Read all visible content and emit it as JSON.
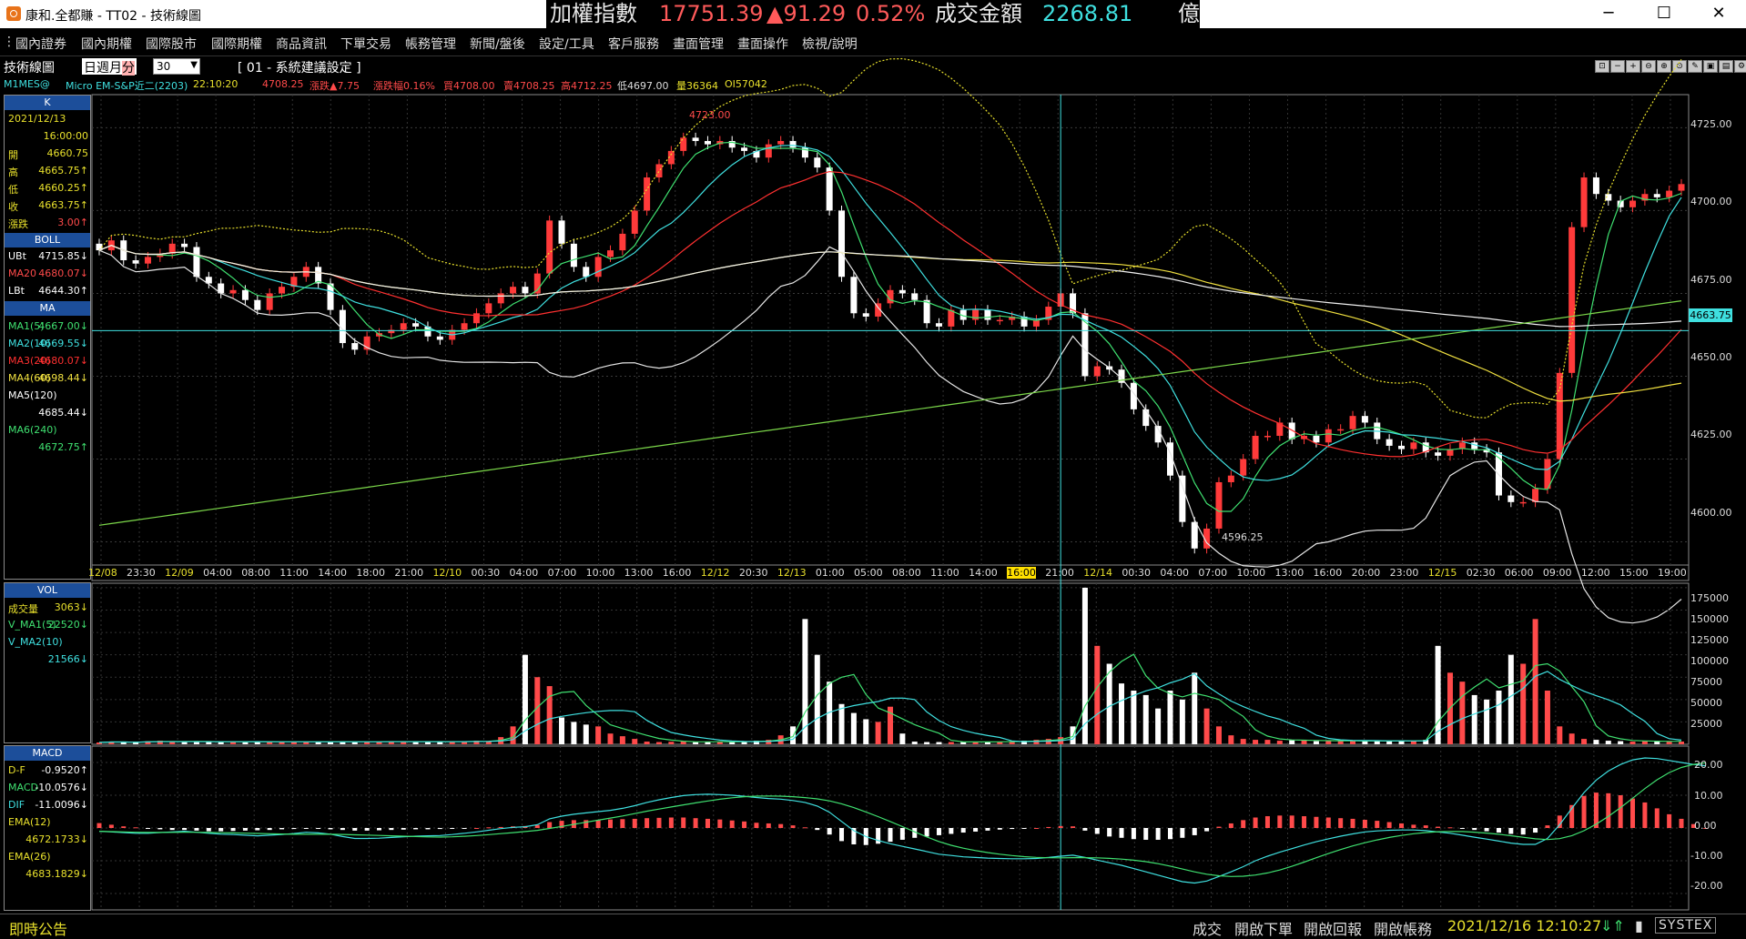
{
  "window": {
    "title": "康和.全都賺 - TT02 - 技術線圖",
    "ticker": {
      "name": "加權指數",
      "price": "17751.39",
      "change": "▲91.29",
      "pct": "0.52%",
      "amount_label": "成交金額",
      "amount": "2268.81",
      "unit": "億"
    },
    "controls": {
      "minimize": "─",
      "maximize": "☐",
      "close": "✕"
    }
  },
  "menu": [
    {
      "label": "國內證券"
    },
    {
      "label": "國內期權"
    },
    {
      "label": "國際股市"
    },
    {
      "label": "國際期權"
    },
    {
      "label": "商品資訊"
    },
    {
      "label": "下單交易"
    },
    {
      "label": "帳務管理"
    },
    {
      "label": "新聞/盤後"
    },
    {
      "label": "設定/工具"
    },
    {
      "label": "客戶服務"
    },
    {
      "label": "畫面管理"
    },
    {
      "label": "畫面操作"
    },
    {
      "label": "檢視/說明"
    }
  ],
  "toolbar": {
    "panel_title": "技術線圖",
    "periods": [
      "日",
      "週",
      "月",
      "分"
    ],
    "interval": "30",
    "setting_name": "[ 01 - 系統建議設定 ]"
  },
  "info": {
    "symbol": "M1MES@",
    "name": "Micro EM-S&P近二(2203)",
    "time": "22:10:20",
    "last": "4708.25",
    "change": "漲跌▲7.75",
    "change_pct": "漲跌幅0.16%",
    "buy": "買4708.00",
    "sell": "賣4708.25",
    "high": "高4712.25",
    "low": "低4697.00",
    "vol": "量36364",
    "oi": "OI57042"
  },
  "side_price": {
    "header": "K",
    "date": "2021/12/13",
    "time": "16:00:00",
    "ohlc": [
      {
        "label": "開",
        "value": "4660.75"
      },
      {
        "label": "高",
        "value": "4665.75↑"
      },
      {
        "label": "低",
        "value": "4660.25↑"
      },
      {
        "label": "收",
        "value": "4663.75↑"
      },
      {
        "label": "漲跌",
        "value": "3.00↑"
      }
    ],
    "boll_header": "BOLL",
    "boll": [
      {
        "label": "UBt",
        "value": "4715.85↓"
      },
      {
        "label": "MA20",
        "value": "4680.07↓"
      },
      {
        "label": "LBt",
        "value": "4644.30↑"
      }
    ],
    "ma_header": "MA",
    "ma": [
      {
        "label": "MA1(5)",
        "value": "4667.00↓"
      },
      {
        "label": "MA2(10)",
        "value": "4669.55↓"
      },
      {
        "label": "MA3(20)",
        "value": "4680.07↓"
      },
      {
        "label": "MA4(60)",
        "value": "4698.44↓"
      },
      {
        "label": "MA5(120)",
        "value": ""
      },
      {
        "label": "",
        "value": "4685.44↓"
      },
      {
        "label": "MA6(240)",
        "value": ""
      },
      {
        "label": "",
        "value": "4672.75↑"
      }
    ]
  },
  "side_vol": {
    "header": "VOL",
    "rows": [
      {
        "label": "成交量",
        "value": "3063↓"
      },
      {
        "label": "V_MA1(5)",
        "value": "22520↓"
      },
      {
        "label": "V_MA2(10)",
        "value": ""
      },
      {
        "label": "",
        "value": "21566↓"
      }
    ]
  },
  "side_macd": {
    "header": "MACD",
    "rows": [
      {
        "label": "D-F",
        "value": "-0.9520↑"
      },
      {
        "label": "MACD",
        "value": "-10.0576↓"
      },
      {
        "label": "DIF",
        "value": "-11.0096↓"
      },
      {
        "label": "EMA(12)",
        "value": ""
      },
      {
        "label": "",
        "value": "4672.1733↓"
      },
      {
        "label": "EMA(26)",
        "value": ""
      },
      {
        "label": "",
        "value": "4683.1829↓"
      }
    ]
  },
  "chart_data": {
    "type": "candlestick",
    "price_axis": {
      "ticks": [
        "4725.00",
        "4700.00",
        "4675.00",
        "4650.00",
        "4625.00",
        "4600.00"
      ],
      "range": [
        4593,
        4735
      ]
    },
    "crosshair_price": "4663.75",
    "crosshair_time": "16:00",
    "high_annotation": "4723.00",
    "low_annotation": "4596.25",
    "x_labels": [
      {
        "text": "12/08",
        "date": true
      },
      {
        "text": "23:30"
      },
      {
        "text": "12/09",
        "date": true
      },
      {
        "text": "04:00"
      },
      {
        "text": "08:00"
      },
      {
        "text": "11:00"
      },
      {
        "text": "14:00"
      },
      {
        "text": "18:00"
      },
      {
        "text": "21:00"
      },
      {
        "text": "12/10",
        "date": true
      },
      {
        "text": "00:30"
      },
      {
        "text": "04:00"
      },
      {
        "text": "07:00"
      },
      {
        "text": "10:00"
      },
      {
        "text": "13:00"
      },
      {
        "text": "16:00"
      },
      {
        "text": "12/12",
        "date": true
      },
      {
        "text": "20:30"
      },
      {
        "text": "12/13",
        "date": true
      },
      {
        "text": "01:00"
      },
      {
        "text": "05:00"
      },
      {
        "text": "08:00"
      },
      {
        "text": "11:00"
      },
      {
        "text": "14:00"
      },
      {
        "text": "16:00",
        "highlight": true
      },
      {
        "text": "21:00"
      },
      {
        "text": "12/14",
        "date": true
      },
      {
        "text": "00:30"
      },
      {
        "text": "04:00"
      },
      {
        "text": "07:00"
      },
      {
        "text": "10:00"
      },
      {
        "text": "13:00"
      },
      {
        "text": "16:00"
      },
      {
        "text": "20:00"
      },
      {
        "text": "23:00"
      },
      {
        "text": "12/15",
        "date": true
      },
      {
        "text": "02:30"
      },
      {
        "text": "06:00"
      },
      {
        "text": "09:00"
      },
      {
        "text": "12:00"
      },
      {
        "text": "15:00"
      },
      {
        "text": "19:00"
      }
    ],
    "close": [
      4688,
      4691,
      4685,
      4684,
      4686,
      4687,
      4690,
      4689,
      4680,
      4678,
      4675,
      4676,
      4673,
      4670,
      4675,
      4677,
      4680,
      4683,
      4678,
      4670,
      4660,
      4658,
      4662,
      4663,
      4664,
      4666,
      4665,
      4662,
      4661,
      4664,
      4666,
      4669,
      4672,
      4675,
      4677,
      4675,
      4681,
      4697,
      4690,
      4683,
      4680,
      4686,
      4688,
      4693,
      4700,
      4710,
      4714,
      4718,
      4722,
      4721,
      4720,
      4721,
      4719,
      4718,
      4716,
      4720,
      4721,
      4719,
      4716,
      4713,
      4700,
      4680,
      4669,
      4668,
      4672,
      4676,
      4675,
      4673,
      4666,
      4665,
      4670,
      4667,
      4670,
      4667,
      4667,
      4668,
      4665,
      4667,
      4671,
      4675,
      4669,
      4650,
      4653,
      4652,
      4648,
      4640,
      4635,
      4630,
      4620,
      4606,
      4598,
      4604,
      4618,
      4620,
      4625,
      4632,
      4632,
      4636,
      4631,
      4632,
      4630,
      4634,
      4634,
      4638,
      4636,
      4631,
      4629,
      4628,
      4630,
      4627,
      4626,
      4628,
      4630,
      4628,
      4627,
      4614,
      4612,
      4612,
      4616,
      4625,
      4651,
      4695,
      4710,
      4705,
      4703,
      4701,
      4703,
      4705,
      4704,
      4706,
      4708
    ],
    "ma_values": [
      {
        "name": "MA1(5)",
        "value": "4667.00"
      },
      {
        "name": "MA2(10)",
        "value": "4669.55"
      },
      {
        "name": "MA3(20)",
        "value": "4680.07"
      },
      {
        "name": "MA4(60)",
        "value": "4698.44"
      },
      {
        "name": "MA5(120)",
        "value": "4685.44"
      },
      {
        "name": "MA6(240)",
        "value": "4672.75"
      }
    ],
    "volume_axis": {
      "ticks": [
        "175000",
        "150000",
        "125000",
        "100000",
        "75000",
        "50000",
        "25000"
      ],
      "max": 180000
    },
    "volume": [
      2000,
      3000,
      2500,
      2000,
      3500,
      4000,
      3000,
      2800,
      2500,
      3000,
      2500,
      2800,
      2500,
      3000,
      2500,
      2800,
      3000,
      2500,
      3000,
      2500,
      3000,
      2500,
      2800,
      3000,
      3200,
      3000,
      2800,
      2500,
      3000,
      2800,
      3500,
      4000,
      3500,
      8000,
      20000,
      100000,
      75000,
      65000,
      30000,
      25000,
      22000,
      20000,
      12000,
      9000,
      6000,
      3000,
      2500,
      2800,
      3000,
      2500,
      3000,
      2800,
      2500,
      3500,
      4000,
      5000,
      10000,
      20000,
      140000,
      100000,
      70000,
      45000,
      35000,
      28000,
      25000,
      42000,
      12000,
      3000,
      2500,
      2500,
      2500,
      2800,
      3000,
      2500,
      3000,
      3500,
      4000,
      5000,
      6000,
      8000,
      20000,
      175000,
      110000,
      90000,
      68000,
      60000,
      55000,
      40000,
      60000,
      50000,
      80000,
      40000,
      20000,
      10000,
      6000,
      5000,
      5000,
      4000,
      4500,
      4500,
      3500,
      4000,
      3500,
      3800,
      3500,
      4000,
      3500,
      3800,
      4000,
      5000,
      110000,
      80000,
      70000,
      55000,
      50000,
      60000,
      100000,
      90000,
      140000,
      60000,
      20000,
      12000,
      6000,
      5000,
      4000,
      3500,
      3000,
      3500,
      3500,
      3000,
      3063
    ],
    "macd_axis": {
      "ticks": [
        "20.00",
        "10.00",
        "0.00",
        "-10.00",
        "-20.00"
      ],
      "range": [
        -25,
        25
      ]
    },
    "macd_osc": [
      1.5,
      1.0,
      0.5,
      0.2,
      -0.2,
      -0.4,
      -0.6,
      -0.6,
      -0.8,
      -1.0,
      -1.0,
      -0.9,
      -0.8,
      -0.7,
      -0.6,
      -0.4,
      -0.3,
      -0.2,
      -0.2,
      -0.4,
      -0.6,
      -0.8,
      -0.8,
      -0.7,
      -0.6,
      -0.5,
      -0.4,
      -0.4,
      -0.3,
      -0.2,
      -0.1,
      0.0,
      0.2,
      0.3,
      0.5,
      0.6,
      0.9,
      1.8,
      2.2,
      2.4,
      2.4,
      2.5,
      2.6,
      2.7,
      2.8,
      3.0,
      3.1,
      3.2,
      3.2,
      3.0,
      2.8,
      2.6,
      2.3,
      2.0,
      1.6,
      1.4,
      1.2,
      0.8,
      0.2,
      -0.6,
      -2.0,
      -4.0,
      -5.0,
      -5.2,
      -4.8,
      -4.2,
      -3.6,
      -3.0,
      -2.6,
      -2.2,
      -1.8,
      -1.4,
      -1.1,
      -0.8,
      -0.5,
      -0.3,
      -0.1,
      0.0,
      0.3,
      0.6,
      0.5,
      -0.8,
      -1.8,
      -2.6,
      -3.0,
      -3.4,
      -3.6,
      -3.6,
      -3.4,
      -3.0,
      -2.2,
      -1.0,
      0.4,
      1.4,
      2.4,
      3.2,
      3.6,
      3.8,
      3.8,
      3.6,
      3.4,
      3.2,
      3.0,
      2.8,
      2.5,
      2.2,
      1.8,
      1.4,
      1.0,
      0.8,
      0.4,
      0.2,
      -0.2,
      -0.6,
      -1.0,
      -1.4,
      -1.8,
      -2.0,
      -1.4,
      0.8,
      3.8,
      7.0,
      9.8,
      10.8,
      10.6,
      10.0,
      9.0,
      7.8,
      6.0,
      4.2,
      2.8,
      1.2,
      0.0
    ],
    "macd_dif": [
      -1.0,
      -1.2,
      -1.4,
      -1.6,
      -1.6,
      -1.4,
      -1.2,
      -1.0,
      -1.3,
      -1.6,
      -1.9,
      -2.0,
      -2.2,
      -2.4,
      -2.2,
      -2.0,
      -1.7,
      -1.3,
      -1.5,
      -1.9,
      -2.6,
      -3.2,
      -3.2,
      -3.1,
      -2.9,
      -2.7,
      -2.5,
      -2.4,
      -2.3,
      -2.0,
      -1.6,
      -1.2,
      -0.7,
      -0.2,
      0.2,
      0.4,
      1.0,
      2.8,
      3.6,
      4.2,
      4.6,
      5.0,
      5.4,
      6.0,
      6.8,
      7.8,
      8.6,
      9.3,
      9.9,
      10.2,
      10.3,
      10.2,
      10.0,
      9.7,
      9.3,
      9.0,
      8.8,
      8.4,
      7.8,
      6.7,
      4.8,
      2.0,
      -0.8,
      -2.6,
      -3.8,
      -4.8,
      -5.6,
      -6.4,
      -7.2,
      -8.0,
      -8.4,
      -8.8,
      -9.0,
      -9.2,
      -9.3,
      -9.4,
      -9.4,
      -9.3,
      -9.0,
      -8.6,
      -8.3,
      -9.0,
      -9.8,
      -10.6,
      -11.4,
      -12.4,
      -13.4,
      -14.4,
      -15.4,
      -16.4,
      -16.8,
      -16.2,
      -14.8,
      -13.4,
      -11.8,
      -10.0,
      -8.6,
      -7.4,
      -6.3,
      -5.2,
      -4.2,
      -3.3,
      -2.5,
      -1.8,
      -1.2,
      -0.9,
      -0.7,
      -0.6,
      -0.6,
      -0.8,
      -1.2,
      -1.6,
      -2.2,
      -2.8,
      -3.4,
      -4.0,
      -4.6,
      -5.0,
      -5.0,
      -3.2,
      1.0,
      6.0,
      10.8,
      14.6,
      17.4,
      19.4,
      20.8,
      21.4,
      21.2,
      20.6,
      20.0,
      19.4,
      19.0
    ]
  }
}
